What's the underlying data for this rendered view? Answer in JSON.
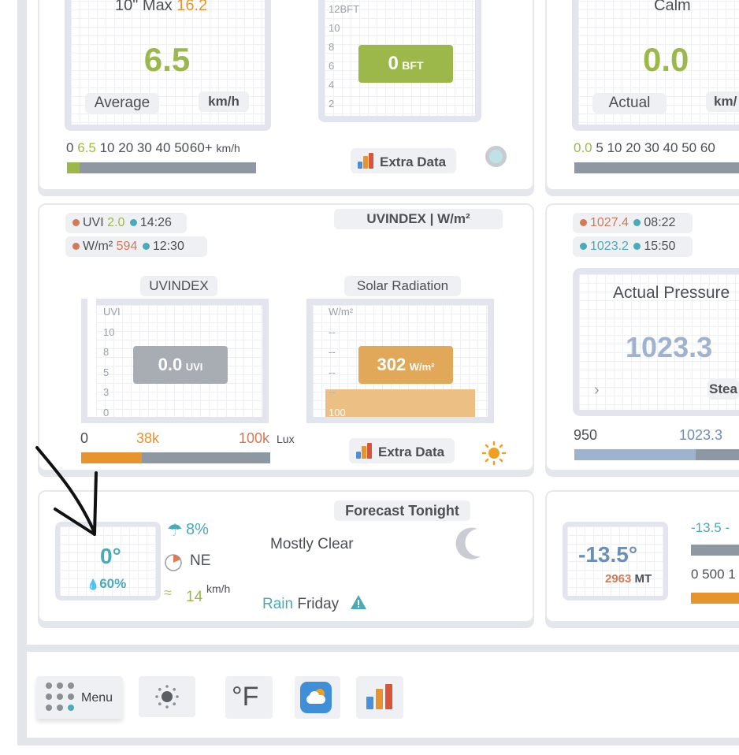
{
  "wind": {
    "max_label": "10\" Max",
    "max_value": "16.2",
    "value": "6.5",
    "avg_label": "Average",
    "unit": "km/h",
    "scale": [
      "0",
      "6.5",
      "10",
      "20",
      "30",
      "40",
      "50",
      "60+",
      "km/h"
    ],
    "progress_fraction": 0.065
  },
  "beaufort": {
    "scale": [
      "12BFT",
      "10",
      "8",
      "6",
      "4",
      "2"
    ],
    "value": "0",
    "unit": "BFT",
    "extra_data": "Extra Data"
  },
  "wind2": {
    "title": "Calm",
    "value": "0.0",
    "actual_label": "Actual",
    "unit": "km/",
    "scale": [
      "0.0",
      "5",
      "10",
      "20",
      "30",
      "40",
      "50",
      "60"
    ]
  },
  "uv": {
    "uvi_label": "UVI",
    "uvi_value": "2.0",
    "uvi_time": "14:26",
    "wm_label": "W/m²",
    "wm_value": "594",
    "wm_time": "12:30",
    "header": "UVINDEX | W/m²",
    "uvindex_title": "UVINDEX",
    "uvi_scale": [
      "UVI",
      "10",
      "8",
      "5",
      "3",
      "0"
    ],
    "uvi_reading": "0.0",
    "uvi_unit": "UVI",
    "solar_title": "Solar Radiation",
    "solar_scale": [
      "W/m²",
      "--",
      "--",
      "--",
      "--",
      "100"
    ],
    "solar_reading": "302",
    "solar_unit": "W/m²",
    "lux_scale": [
      "0",
      "38k",
      "100k",
      "Lux"
    ],
    "lux_fraction": 0.32,
    "extra_data": "Extra Data"
  },
  "pressure": {
    "high_value": "1027.4",
    "high_time": "08:22",
    "low_value": "1023.2",
    "low_time": "15:50",
    "title": "Actual Pressure",
    "value": "1023.3",
    "trend": "Stea",
    "scale_min": "950",
    "scale_current": "1023.3"
  },
  "forecast": {
    "temp": "0°",
    "humidity": "60%",
    "rain_chance": "8%",
    "wind_dir": "NE",
    "wind_speed": "14",
    "wind_unit": "km/h",
    "header": "Forecast Tonight",
    "condition": "Mostly Clear",
    "rain_label": "Rain",
    "rain_day": "Friday"
  },
  "dewpoint": {
    "value": "-13.5°",
    "altitude": "2963",
    "altitude_unit": "MT",
    "scale_a": "-13.5 -",
    "scale_b": "0 500 1"
  },
  "toolbar": {
    "menu_label": "Menu",
    "unit_label": "°F"
  },
  "colors": {
    "green": "#9cb84a",
    "orange": "#e8942e",
    "teal": "#4aaab8",
    "rust": "#d27a55",
    "gray_bar": "#8d98a3",
    "blue_bar": "#9fb3cf"
  }
}
